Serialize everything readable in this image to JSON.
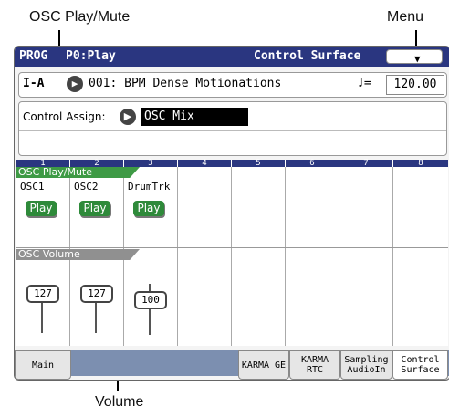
{
  "callouts": {
    "osc_play_mute": "OSC Play/Mute",
    "menu": "Menu",
    "volume": "Volume"
  },
  "titlebar": {
    "mode": "PROG",
    "page": "P0:Play",
    "screen": "Control Surface",
    "menu_icon": "chevron-down-icon"
  },
  "program": {
    "bank": "I-A",
    "number_name": "001: BPM Dense Motionations",
    "tempo_symbol": "♩=",
    "tempo": "120.00"
  },
  "assign": {
    "label": "Control Assign:",
    "value": "OSC Mix"
  },
  "columns": [
    "1",
    "2",
    "3",
    "4",
    "5",
    "6",
    "7",
    "8"
  ],
  "sections": {
    "play_mute": "OSC Play/Mute",
    "volume": "OSC Volume"
  },
  "slots": [
    {
      "name": "OSC1",
      "button": "Play",
      "value": "127"
    },
    {
      "name": "OSC2",
      "button": "Play",
      "value": "127"
    },
    {
      "name": "DrumTrk",
      "button": "Play",
      "value": "100"
    }
  ],
  "tabs": [
    {
      "label": "Main"
    },
    {
      "label": "KARMA GE"
    },
    {
      "label": "KARMA RTC"
    },
    {
      "label": "Sampling AudioIn"
    },
    {
      "label": "Control Surface"
    }
  ],
  "colors": {
    "header": "#2a3680",
    "section_green": "#3e9a45",
    "section_gray": "#909090",
    "play_green": "#2e8a3a"
  }
}
